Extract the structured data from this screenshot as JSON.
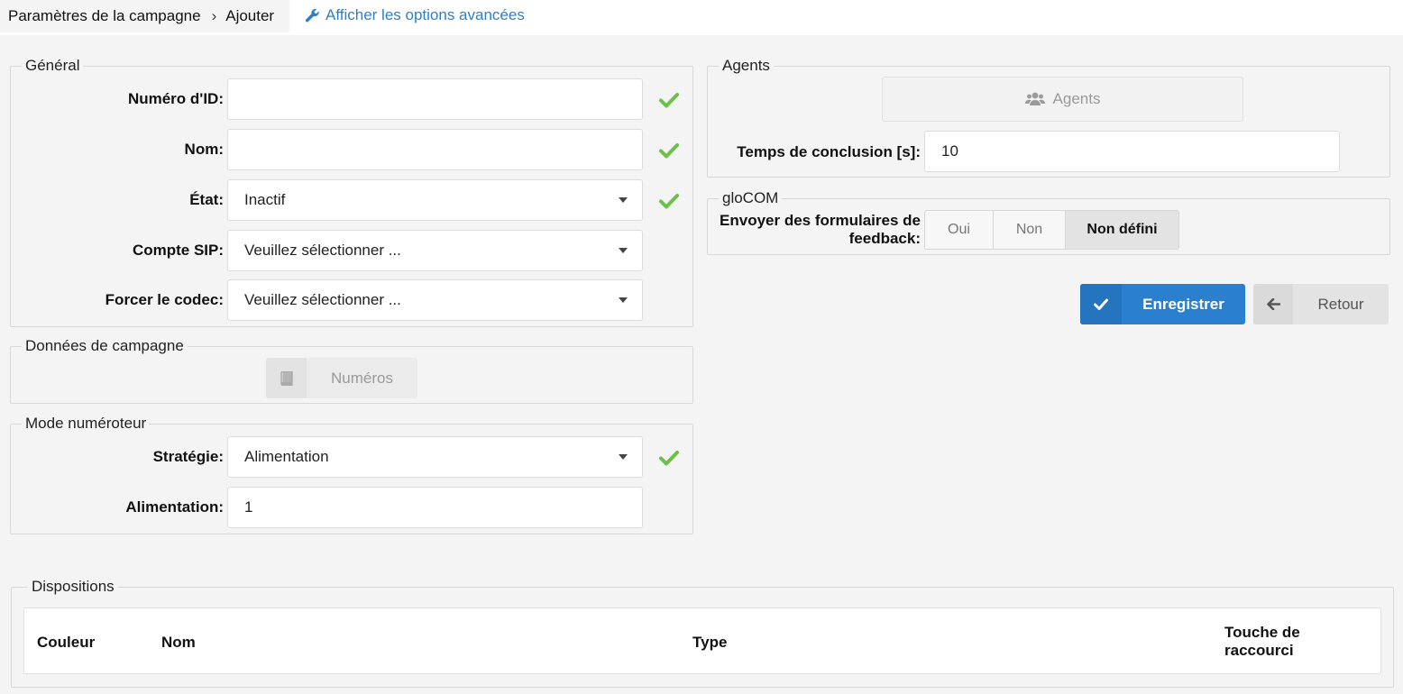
{
  "breadcrumb": {
    "parent": "Paramètres de la campagne",
    "separator": "›",
    "current": "Ajouter"
  },
  "advanced_link": "Afficher les options avancées",
  "general": {
    "legend": "Général",
    "id_label": "Numéro d'ID:",
    "id_value": "",
    "name_label": "Nom:",
    "name_value": "",
    "state_label": "État:",
    "state_value": "Inactif",
    "sip_label": "Compte SIP:",
    "sip_value": "Veuillez sélectionner ...",
    "codec_label": "Forcer le codec:",
    "codec_value": "Veuillez sélectionner ..."
  },
  "campaign_data": {
    "legend": "Données de campagne",
    "numbers_button": "Numéros"
  },
  "dialer": {
    "legend": "Mode numéroteur",
    "strategy_label": "Stratégie:",
    "strategy_value": "Alimentation",
    "feed_label": "Alimentation:",
    "feed_value": "1"
  },
  "agents": {
    "legend": "Agents",
    "agents_button": "Agents",
    "wrapup_label": "Temps de conclusion [s]:",
    "wrapup_value": "10"
  },
  "glocom": {
    "legend": "gloCOM",
    "feedback_label_1": "Envoyer des formulaires de",
    "feedback_label_2": "feedback:",
    "options": [
      "Oui",
      "Non",
      "Non défini"
    ],
    "selected": "Non défini"
  },
  "actions": {
    "save": "Enregistrer",
    "back": "Retour"
  },
  "dispositions": {
    "legend": "Dispositions",
    "columns": [
      "Couleur",
      "Nom",
      "Type",
      "Touche de",
      "raccourci"
    ]
  },
  "colors": {
    "accent": "#2a80cf",
    "check": "#6cc04a",
    "link": "#2f7fc1"
  }
}
